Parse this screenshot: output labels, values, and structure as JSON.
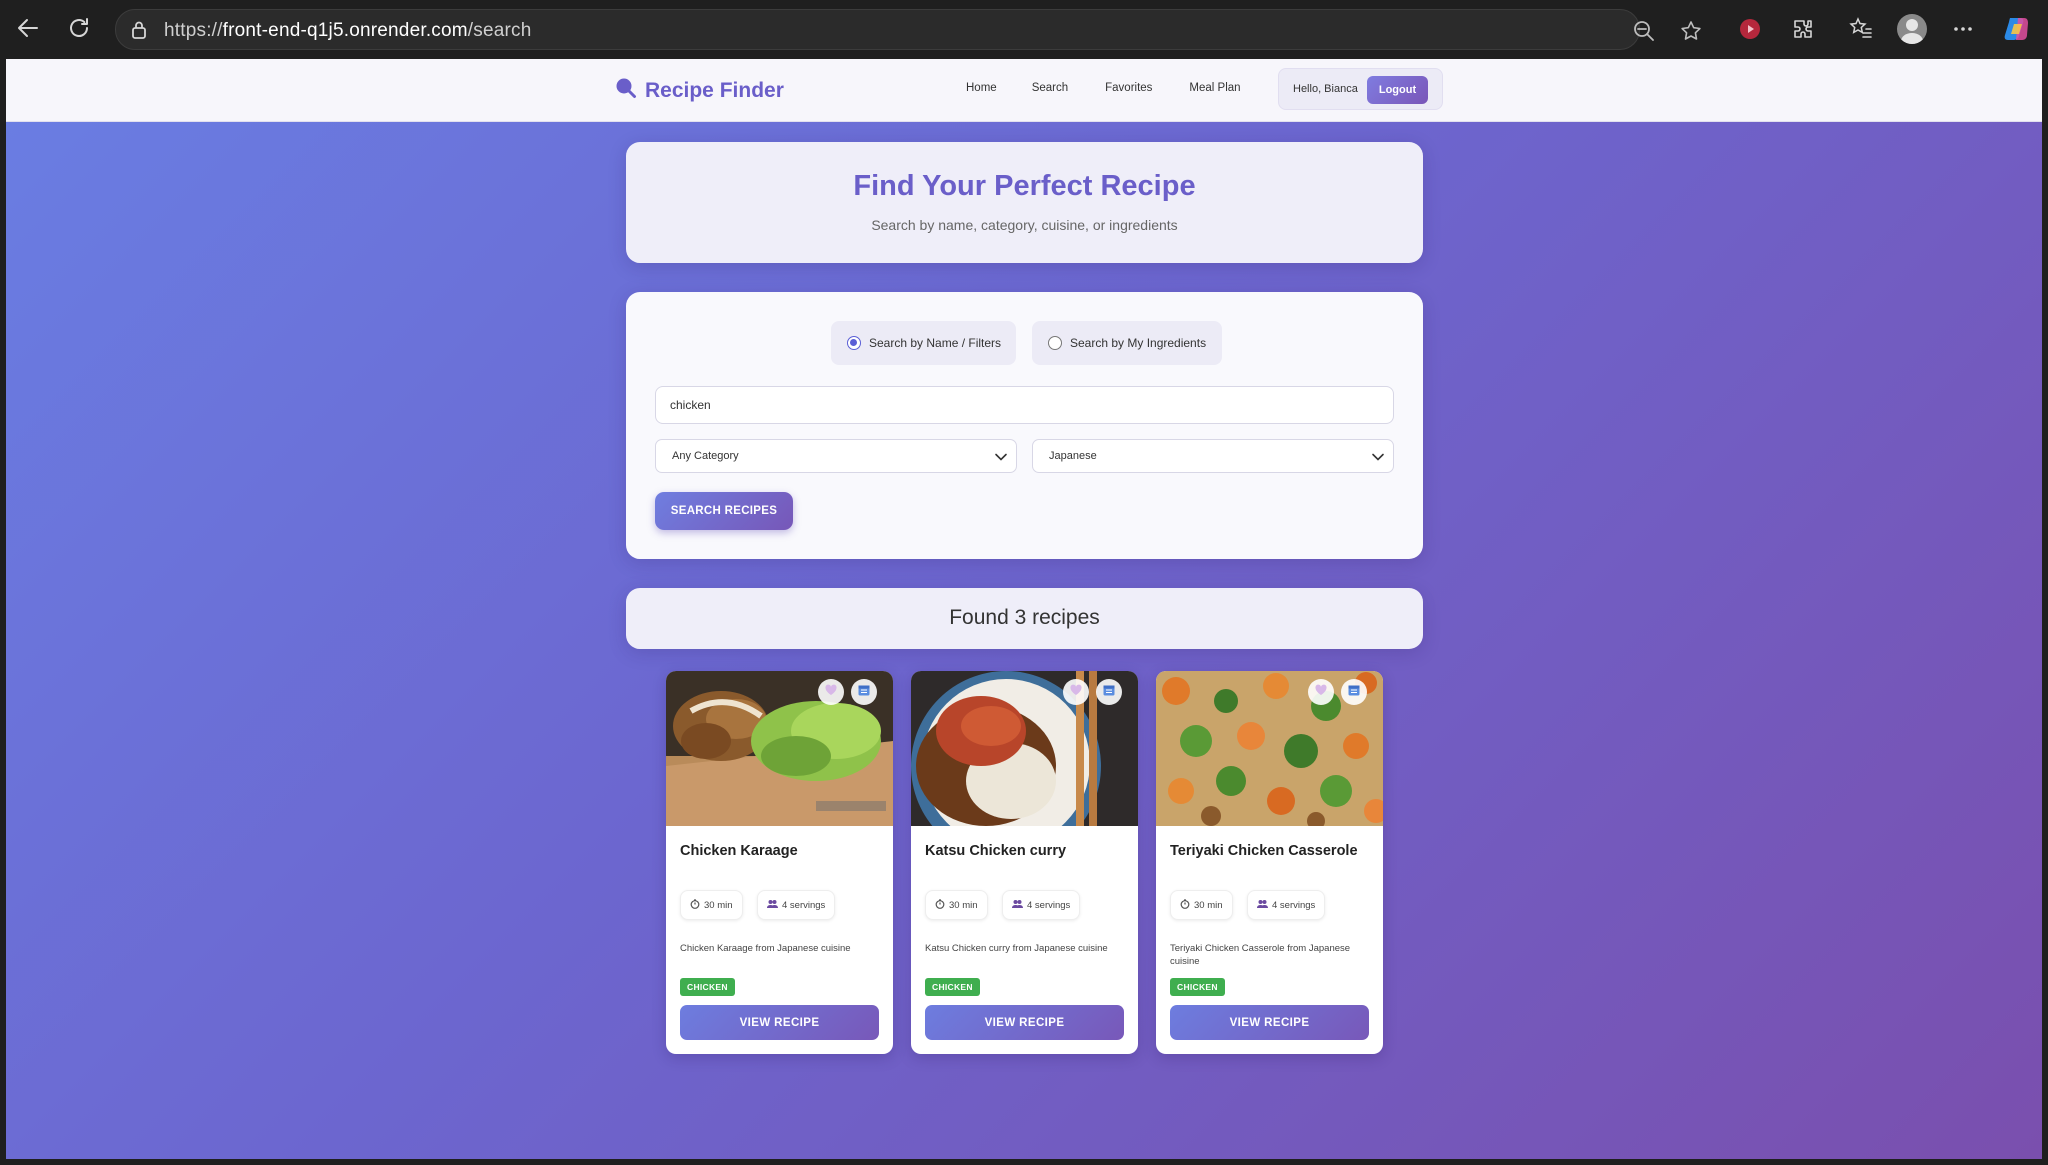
{
  "browser": {
    "url_prefix": "https://",
    "url_host": "front-end-q1j5.onrender.com",
    "url_path": "/search"
  },
  "app": {
    "brand": "Recipe Finder",
    "nav": [
      "Home",
      "Search",
      "Favorites",
      "Meal Plan"
    ],
    "greeting": "Hello, Bianca",
    "logout_label": "Logout"
  },
  "hero": {
    "title": "Find Your Perfect Recipe",
    "subtitle": "Search by name, category, cuisine, or ingredients"
  },
  "search": {
    "mode_options": [
      "Search by Name / Filters",
      "Search by My Ingredients"
    ],
    "selected_mode": "Search by Name / Filters",
    "query": "chicken",
    "category": "Any Category",
    "cuisine": "Japanese",
    "button_label": "SEARCH RECIPES"
  },
  "results": {
    "heading": "Found 3 recipes",
    "recipes": [
      {
        "title": "Chicken Karaage",
        "time": "30 min",
        "servings": "4 servings",
        "description": "Chicken Karaage from Japanese cuisine",
        "tag": "CHICKEN",
        "button": "VIEW RECIPE"
      },
      {
        "title": "Katsu Chicken curry",
        "time": "30 min",
        "servings": "4 servings",
        "description": "Katsu Chicken curry from Japanese cuisine",
        "tag": "CHICKEN",
        "button": "VIEW RECIPE"
      },
      {
        "title": "Teriyaki Chicken Casserole",
        "time": "30 min",
        "servings": "4 servings",
        "description": "Teriyaki Chicken Casserole from Japanese cuisine",
        "tag": "CHICKEN",
        "button": "VIEW RECIPE"
      }
    ]
  },
  "colors": {
    "brand": "#6a5ec9",
    "gradient_start": "#6a7ee3",
    "gradient_end": "#7a4fae",
    "tag_green": "#3fae4f"
  },
  "icons": [
    "back-icon",
    "refresh-icon",
    "lock-icon",
    "zoom-out-icon",
    "star-icon",
    "record-icon",
    "extensions-icon",
    "favorites-icon",
    "profile-icon",
    "more-icon",
    "copilot-icon",
    "search-icon",
    "heart-icon",
    "calendar-icon",
    "timer-icon",
    "people-icon",
    "chevron-down-icon"
  ]
}
